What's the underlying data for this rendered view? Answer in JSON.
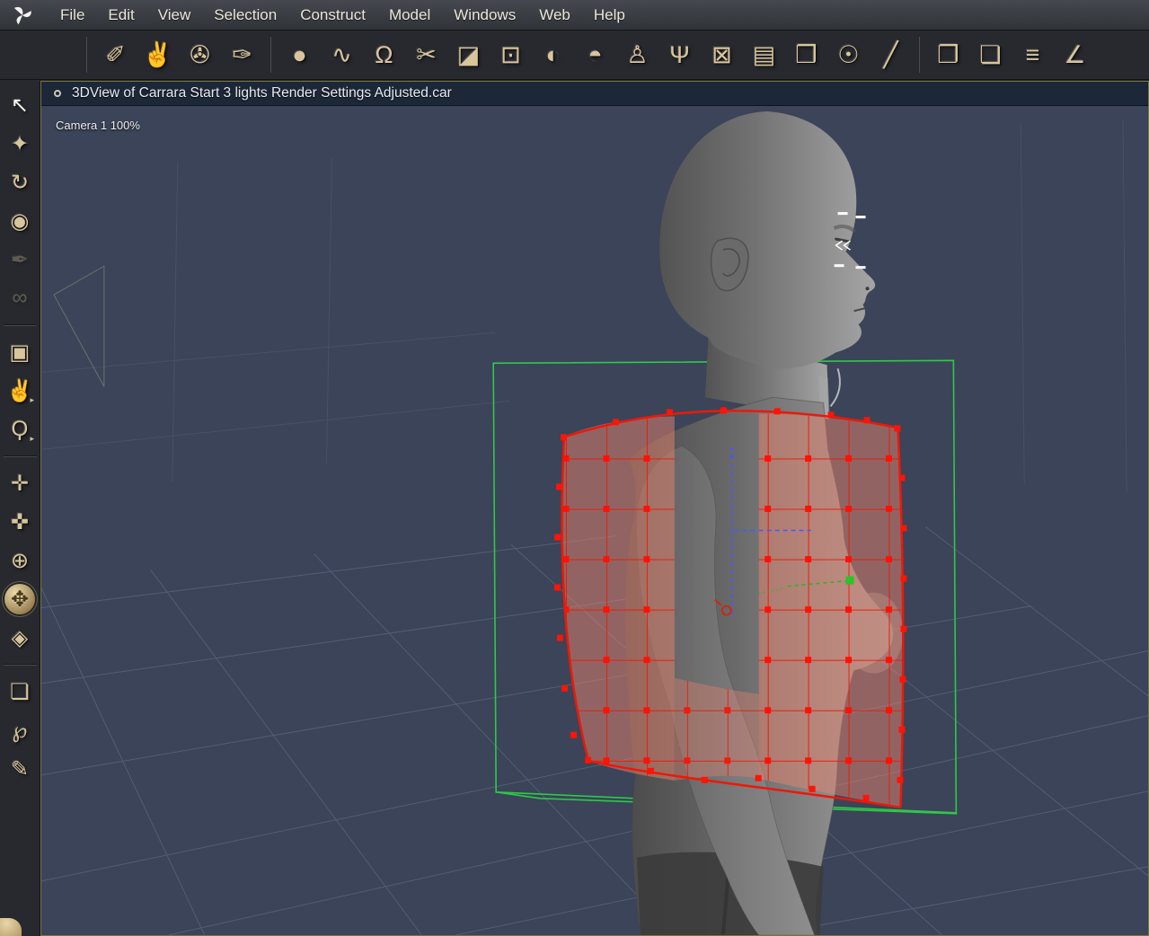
{
  "app": {
    "name": "Carrara",
    "logo_icon": "carrara-pinwheel-icon"
  },
  "menubar": {
    "items": [
      "File",
      "Edit",
      "View",
      "Selection",
      "Construct",
      "Model",
      "Windows",
      "Web",
      "Help"
    ]
  },
  "toolbar": {
    "groups": [
      {
        "name": "edit-tools",
        "tools": [
          {
            "name": "spline-edit-tool-icon",
            "glyph": "✐"
          },
          {
            "name": "hand-tool-icon",
            "glyph": "✌"
          },
          {
            "name": "wrench-tool-icon",
            "glyph": "✇"
          },
          {
            "name": "smooth-trowel-tool-icon",
            "glyph": "✑"
          }
        ]
      },
      {
        "name": "modeling-tools",
        "tools": [
          {
            "name": "sphere-primitive-tool-icon",
            "glyph": "●"
          },
          {
            "name": "polyline-tool-icon",
            "glyph": "∿"
          },
          {
            "name": "magnet-tool-icon",
            "glyph": "Ω"
          },
          {
            "name": "scissors-tool-icon",
            "glyph": "✂"
          },
          {
            "name": "knife-tool-icon",
            "glyph": "◪"
          },
          {
            "name": "marquee-modeler-tool-icon",
            "glyph": "⊡"
          },
          {
            "name": "half-sphere-tool-icon",
            "glyph": "◐"
          },
          {
            "name": "dome-lantern-tool-icon",
            "glyph": "◓"
          },
          {
            "name": "vase-lathe-tool-icon",
            "glyph": "♙"
          },
          {
            "name": "goblet-tool-icon",
            "glyph": "Ψ"
          },
          {
            "name": "delete-face-tool-icon",
            "glyph": "⊠"
          },
          {
            "name": "stack-layers-tool-icon",
            "glyph": "▤"
          },
          {
            "name": "bag-tool-icon",
            "glyph": "❒"
          },
          {
            "name": "sphere-paint-tool-icon",
            "glyph": "☉"
          },
          {
            "name": "line-tool-icon",
            "glyph": "╱"
          }
        ]
      },
      {
        "name": "surface-tools",
        "tools": [
          {
            "name": "page-unfold-tool-icon",
            "glyph": "❐"
          },
          {
            "name": "page-wrap-tool-icon",
            "glyph": "❏"
          },
          {
            "name": "text-3d-tool-icon",
            "glyph": "≡"
          },
          {
            "name": "angle-ruler-tool-icon",
            "glyph": "∠"
          }
        ]
      }
    ]
  },
  "sidebar": {
    "items": [
      {
        "name": "select-arrow-tool-icon",
        "glyph": "↖",
        "bright": true
      },
      {
        "name": "transform-star-tool-icon",
        "glyph": "✦"
      },
      {
        "name": "rotate-tool-icon",
        "glyph": "↻"
      },
      {
        "name": "trackball-rotate-tool-icon",
        "glyph": "◉"
      },
      {
        "name": "eyedropper-tool-icon",
        "glyph": "✒",
        "dim": true
      },
      {
        "name": "link-tool-icon",
        "glyph": "∞",
        "dim": true
      },
      {
        "sep": true
      },
      {
        "name": "camera-tool-icon",
        "glyph": "▣"
      },
      {
        "name": "pan-hand-tool-icon",
        "glyph": "✌",
        "flyout": true
      },
      {
        "name": "zoom-tool-icon",
        "glyph": "Ϙ",
        "flyout": true
      },
      {
        "sep": true
      },
      {
        "name": "move-camera-tool-icon",
        "glyph": "✛"
      },
      {
        "name": "pan-camera-tool-icon",
        "glyph": "✜"
      },
      {
        "name": "dolly-camera-tool-icon",
        "glyph": "⊕"
      },
      {
        "name": "universal-manipulator-tool-icon",
        "glyph": "✥",
        "active": true
      },
      {
        "name": "drawing-plane-tool-icon",
        "glyph": "◈"
      },
      {
        "sep": true
      },
      {
        "name": "marquee-select-tool-icon",
        "glyph": "❏"
      },
      {
        "name": "lasso-select-tool-icon",
        "glyph": "℘"
      },
      {
        "name": "paintbrush-select-tool-icon",
        "glyph": "✎"
      }
    ]
  },
  "viewport": {
    "title": "3DView of Carrara Start 3 lights Render Settings Adjusted.car",
    "camera_label": "Camera 1 100%"
  },
  "colors": {
    "selection_green": "#2ed04a",
    "mesh_red": "#ee1808",
    "viewport_background": "#3b4458",
    "icon_beige": "#d9c59c",
    "titlebar_navy": "#1c2737"
  }
}
